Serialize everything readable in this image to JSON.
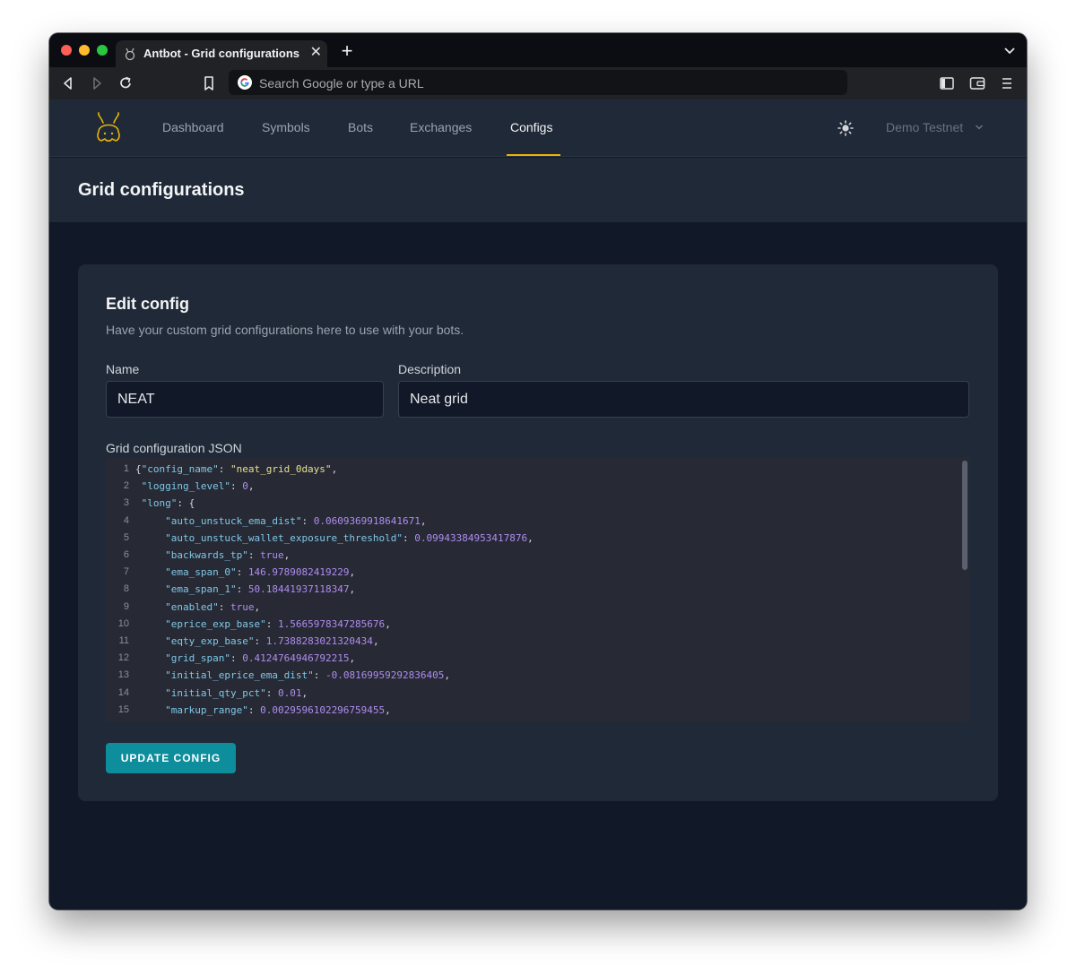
{
  "browser": {
    "tab_title": "Antbot - Grid configurations",
    "tab_close": "✕",
    "new_tab": "+",
    "omnibox_placeholder": "Search Google or type a URL"
  },
  "nav": {
    "links": [
      "Dashboard",
      "Symbols",
      "Bots",
      "Exchanges",
      "Configs"
    ],
    "active": "Configs",
    "account": "Demo Testnet",
    "accent_color": "#eab308"
  },
  "page": {
    "title": "Grid configurations"
  },
  "form": {
    "heading": "Edit config",
    "subtitle": "Have your custom grid configurations here to use with your bots.",
    "name_label": "Name",
    "name_value": "NEAT",
    "description_label": "Description",
    "description_value": "Neat grid",
    "json_label": "Grid configuration JSON",
    "submit_label": "UPDATE CONFIG",
    "submit_color": "#0e8e9c"
  },
  "editor": {
    "lines": [
      {
        "n": "1",
        "indent": "",
        "open": "{",
        "key": "config_name",
        "val": "neat_grid_0days",
        "type": "s",
        "trail": ","
      },
      {
        "n": "2",
        "indent": " ",
        "key": "logging_level",
        "val": "0",
        "type": "n",
        "trail": ","
      },
      {
        "n": "3",
        "indent": " ",
        "key": "long",
        "val": "{",
        "type": "p",
        "trail": ""
      },
      {
        "n": "4",
        "indent": "     ",
        "key": "auto_unstuck_ema_dist",
        "val": "0.0609369918641671",
        "type": "n",
        "trail": ","
      },
      {
        "n": "5",
        "indent": "     ",
        "key": "auto_unstuck_wallet_exposure_threshold",
        "val": "0.09943384953417876",
        "type": "n",
        "trail": ","
      },
      {
        "n": "6",
        "indent": "     ",
        "key": "backwards_tp",
        "val": "true",
        "type": "b",
        "trail": ","
      },
      {
        "n": "7",
        "indent": "     ",
        "key": "ema_span_0",
        "val": "146.9789082419229",
        "type": "n",
        "trail": ","
      },
      {
        "n": "8",
        "indent": "     ",
        "key": "ema_span_1",
        "val": "50.18441937118347",
        "type": "n",
        "trail": ","
      },
      {
        "n": "9",
        "indent": "     ",
        "key": "enabled",
        "val": "true",
        "type": "b",
        "trail": ","
      },
      {
        "n": "10",
        "indent": "     ",
        "key": "eprice_exp_base",
        "val": "1.5665978347285676",
        "type": "n",
        "trail": ","
      },
      {
        "n": "11",
        "indent": "     ",
        "key": "eqty_exp_base",
        "val": "1.7388283021320434",
        "type": "n",
        "trail": ","
      },
      {
        "n": "12",
        "indent": "     ",
        "key": "grid_span",
        "val": "0.4124764946792215",
        "type": "n",
        "trail": ","
      },
      {
        "n": "13",
        "indent": "     ",
        "key": "initial_eprice_ema_dist",
        "val": "-0.08169959292836405",
        "type": "n",
        "trail": ","
      },
      {
        "n": "14",
        "indent": "     ",
        "key": "initial_qty_pct",
        "val": "0.01",
        "type": "n",
        "trail": ","
      },
      {
        "n": "15",
        "indent": "     ",
        "key": "markup_range",
        "val": "0.0029596102296759455",
        "type": "n",
        "trail": ","
      }
    ]
  }
}
